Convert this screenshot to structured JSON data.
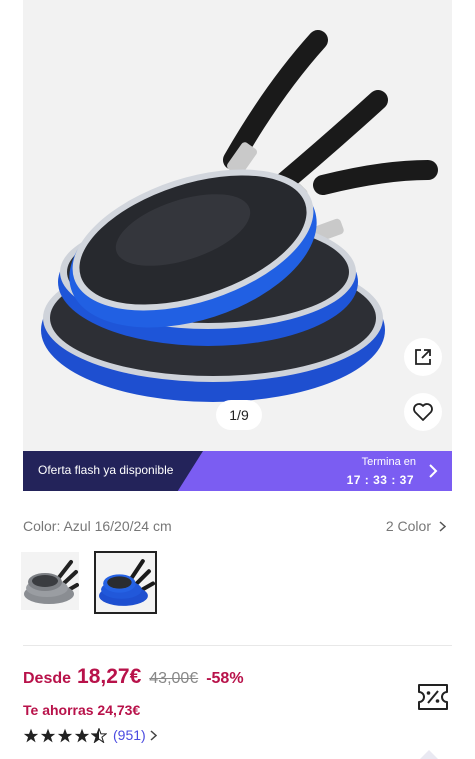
{
  "gallery": {
    "pager_text": "1/9",
    "icons": {
      "share": "external-link-icon",
      "favorite": "heart-icon"
    }
  },
  "flash": {
    "text": "Oferta flash ya disponible",
    "ends_label": "Termina en",
    "timer": "17 : 33 : 37"
  },
  "color": {
    "label": "Color: Azul 16/20/24 cm",
    "count": "2 Color",
    "options": [
      "grey",
      "blue"
    ]
  },
  "price": {
    "from": "Desde",
    "current": "18,27€",
    "original": "43,00€",
    "discount": "-58%",
    "savings": "Te ahorras 24,73€"
  },
  "rating": {
    "stars": 4.5,
    "reviews": "(951)"
  },
  "colors": {
    "accent": "#b8124a",
    "flash_dark": "#23235a",
    "flash_purple": "#7b5df2",
    "link": "#4a4ae0"
  }
}
